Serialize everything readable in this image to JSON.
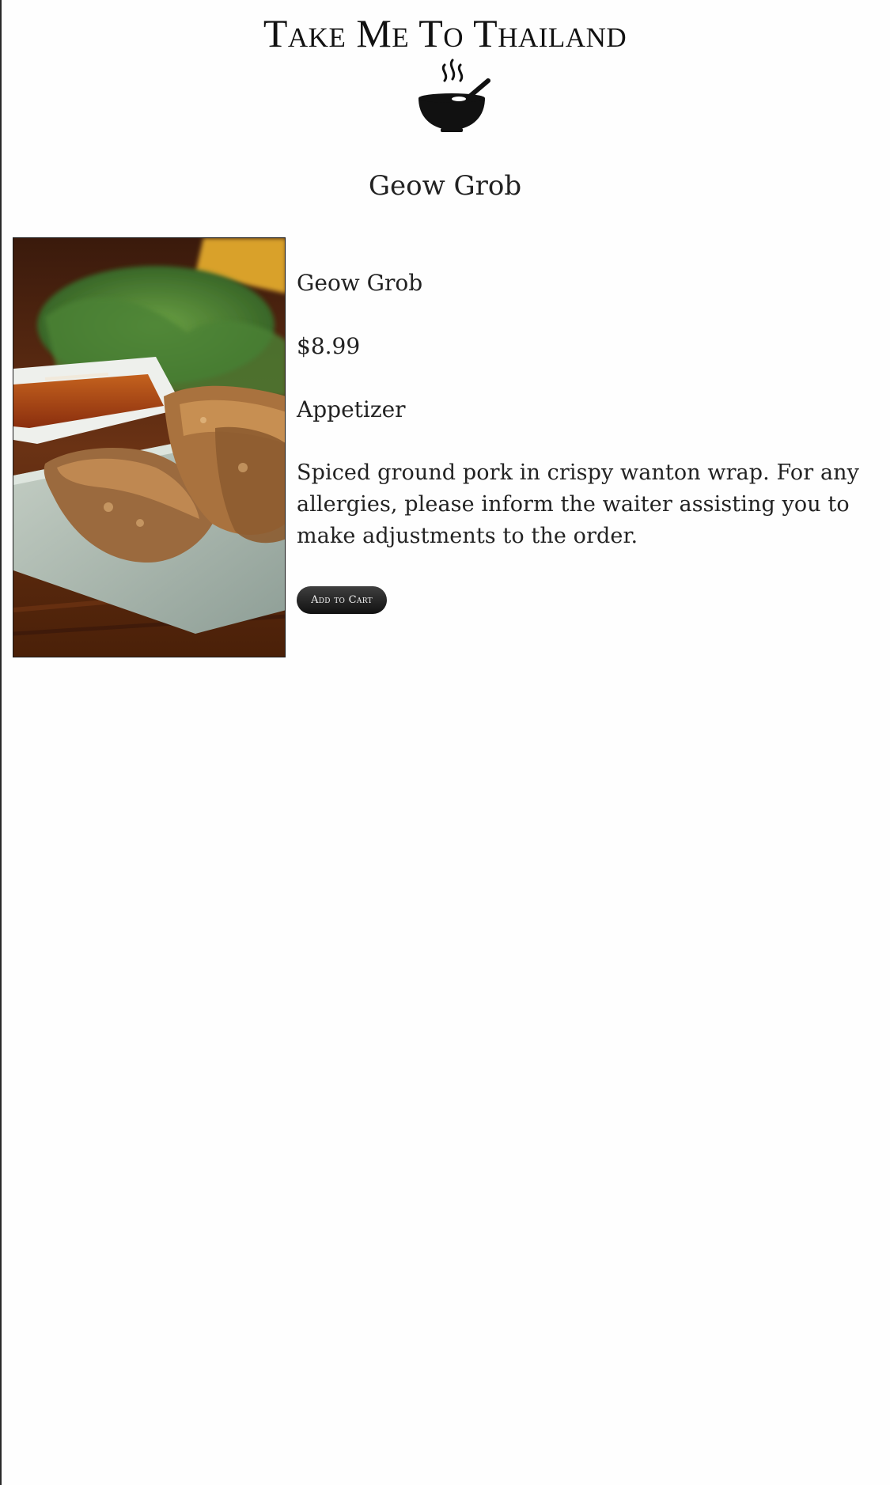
{
  "header": {
    "brand_title": "Take Me To Thailand",
    "logo_icon": "steaming-bowl-icon"
  },
  "page": {
    "title": "Geow Grob"
  },
  "item": {
    "name": "Geow Grob",
    "price": "$8.99",
    "category": "Appetizer",
    "description": "Spiced ground pork in crispy wanton wrap. For any allergies, please inform the waiter assisting you to make adjustments to the order.",
    "image_alt": "Geow Grob"
  },
  "actions": {
    "add_to_cart_label": "Add to Cart"
  },
  "colors": {
    "button_bg": "#222222",
    "text": "#1b1b1b",
    "background": "#fefefe"
  }
}
